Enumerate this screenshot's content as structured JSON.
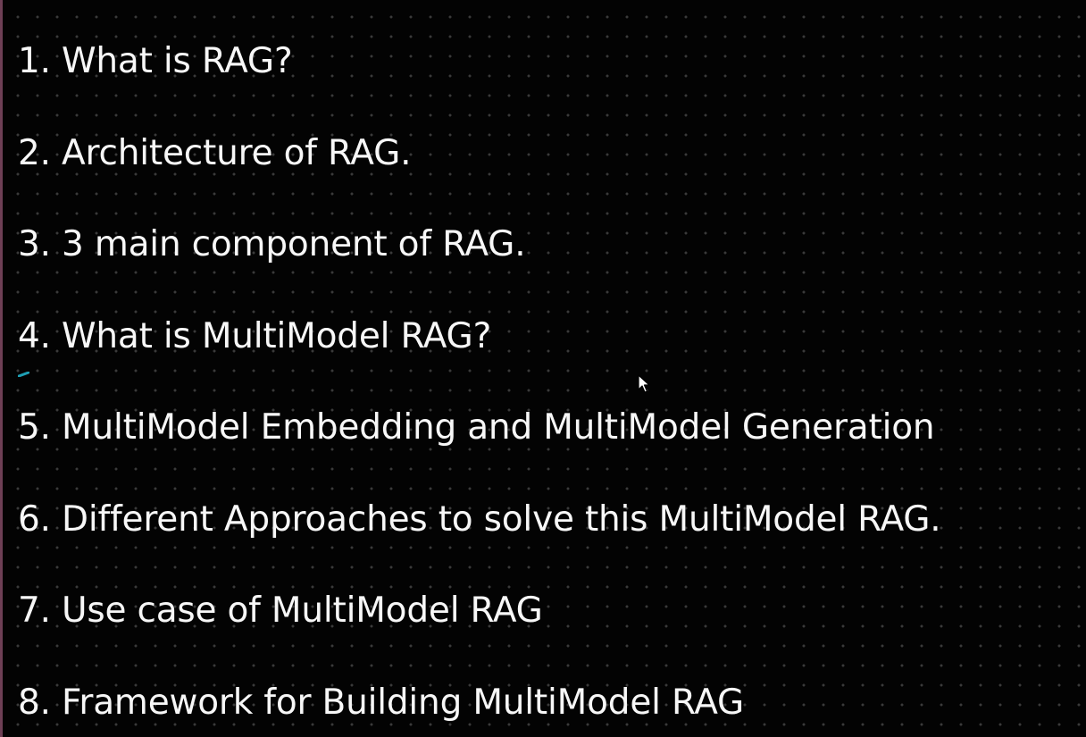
{
  "agenda": {
    "items": [
      "1. What is RAG?",
      "2. Architecture of RAG.",
      "3. 3 main component of RAG.",
      "4. What is MultiModel RAG?",
      "5. MultiModel Embedding and MultiModel Generation",
      "6. Different Approaches to solve this MultiModel RAG.",
      "7. Use case of MultiModel RAG",
      "8. Framework for Building MultiModel RAG"
    ]
  },
  "colors": {
    "background": "#030303",
    "text": "#f7f7f7",
    "grid_dots": "#3a3a3a",
    "left_edge": "#6e3f55",
    "ink_mark": "#1e9fb4"
  },
  "icons": {
    "pointer": "mouse-pointer-icon",
    "ink": "pen-ink-mark"
  }
}
